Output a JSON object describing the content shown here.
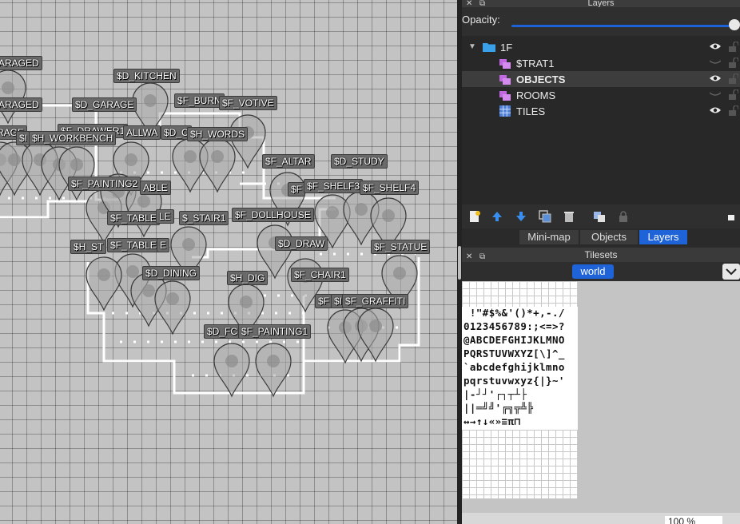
{
  "map": {
    "labels": [
      {
        "text": "ARAGED"
      },
      {
        "text": "$D_KITCHEN"
      },
      {
        "text": "ARAGED"
      },
      {
        "text": "$D_GARAGE"
      },
      {
        "text": "$F_BURN"
      },
      {
        "text": "$F_VOTIVE"
      },
      {
        "text": "ARAGE"
      },
      {
        "text": "$F_DRAWER1"
      },
      {
        "text": "ALLWA"
      },
      {
        "text": "$D_C"
      },
      {
        "text": "$H_WORDS"
      },
      {
        "text": "$I"
      },
      {
        "text": "$H_WORKBENCH"
      },
      {
        "text": "$F_ALTAR"
      },
      {
        "text": "$D_STUDY"
      },
      {
        "text": "$F_PAINTING2"
      },
      {
        "text": "ABLE"
      },
      {
        "text": "$F"
      },
      {
        "text": "$F_SHELF3"
      },
      {
        "text": "$F_SHELF4"
      },
      {
        "text": "$F_TABLE"
      },
      {
        "text": "LE"
      },
      {
        "text": "$_STAIR1"
      },
      {
        "text": "$F_DOLLHOUSE"
      },
      {
        "text": "$H_ST"
      },
      {
        "text": "$F_TABLE"
      },
      {
        "text": "E"
      },
      {
        "text": "$D_DRAW"
      },
      {
        "text": "$F_STATUE"
      },
      {
        "text": "$D_DINING"
      },
      {
        "text": "$H_DIG"
      },
      {
        "text": "$F_CHAIR1"
      },
      {
        "text": "$F"
      },
      {
        "text": "$I"
      },
      {
        "text": "$F_GRAFFITI"
      },
      {
        "text": "$D_FC"
      },
      {
        "text": "$F_PAINTING1"
      }
    ]
  },
  "layers_panel": {
    "title": "Layers",
    "opacity_label": "Opacity:",
    "opacity": 1.0,
    "tree": [
      {
        "name": "1F",
        "type": "group",
        "expanded": true,
        "visible": true,
        "locked": false,
        "selected": false
      },
      {
        "name": "$TRAT1",
        "type": "object",
        "visible": false,
        "locked": false,
        "selected": false
      },
      {
        "name": "OBJECTS",
        "type": "object",
        "visible": true,
        "locked": false,
        "selected": true
      },
      {
        "name": "ROOMS",
        "type": "object",
        "visible": false,
        "locked": false,
        "selected": false
      },
      {
        "name": "TILES",
        "type": "tile",
        "visible": true,
        "locked": false,
        "selected": false
      }
    ],
    "tabs": [
      {
        "label": "Mini-map",
        "active": false
      },
      {
        "label": "Objects",
        "active": false
      },
      {
        "label": "Layers",
        "active": true
      }
    ]
  },
  "tilesets_panel": {
    "title": "Tilesets",
    "tileset_tab": "world",
    "glyph_rows": [
      " !\"#$%&'()*+,-./",
      "0123456789:;<=>?",
      "@ABCDEFGHIJKLMNO",
      "PQRSTUVWXYZ[\\]^_",
      "`abcdefghijklmno",
      "pqrstuvwxyz{|}~'",
      "|-┘┘'┌┐┬┴├",
      "||═╝╝'╔╗╦╩╠",
      "↔→↑↓«»≡π⊓"
    ],
    "zoom": "100 %"
  },
  "colors": {
    "accent": "#1e63d8",
    "panel_bg": "#2b2b2b",
    "map_bg": "#c3c3c3"
  }
}
